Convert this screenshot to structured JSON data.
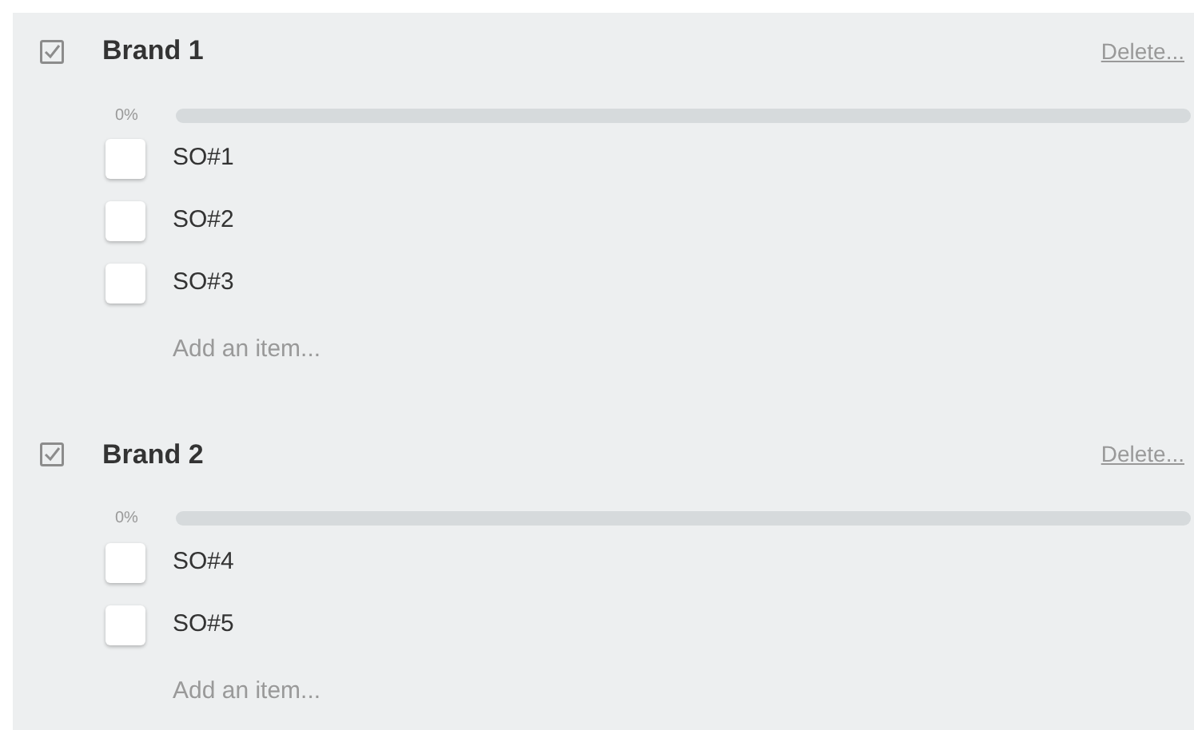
{
  "checklists": [
    {
      "title": "Brand 1",
      "delete_label": "Delete...",
      "progress": {
        "reading": "0%",
        "level": 0
      },
      "items": [
        {
          "label": "SO#1",
          "checked": false
        },
        {
          "label": "SO#2",
          "checked": false
        },
        {
          "label": "SO#3",
          "checked": false
        }
      ],
      "add_item_label": "Add an item..."
    },
    {
      "title": "Brand 2",
      "delete_label": "Delete...",
      "progress": {
        "reading": "0%",
        "level": 0
      },
      "items": [
        {
          "label": "SO#4",
          "checked": false
        },
        {
          "label": "SO#5",
          "checked": false
        }
      ],
      "add_item_label": "Add an item..."
    }
  ]
}
